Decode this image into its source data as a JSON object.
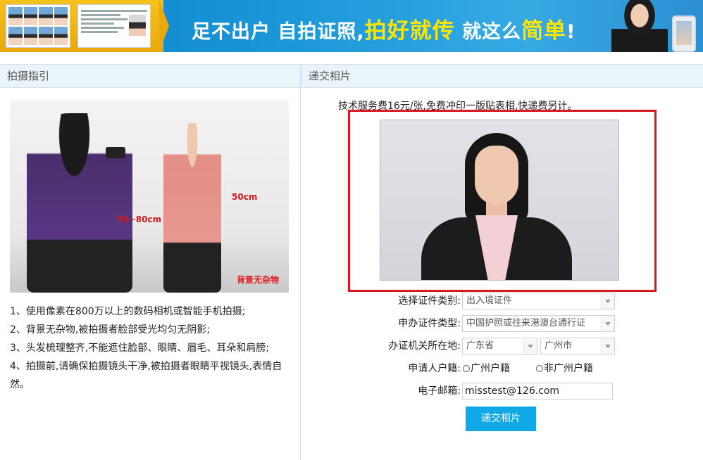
{
  "banner": {
    "slogan_part1": "足不出户 自拍证照,",
    "slogan_highlight1": "拍好就传",
    "slogan_part2": " 就这么",
    "slogan_highlight2": "简单",
    "slogan_end": "!"
  },
  "left": {
    "heading": "拍摄指引",
    "scene_labels": {
      "width_label": "50~80cm",
      "distance_label": "50cm",
      "background_note": "背景无杂物"
    },
    "instructions": [
      "1、使用像素在800万以上的数码相机或智能手机拍摄;",
      "2、背景无杂物,被拍摄者脸部受光均匀无阴影;",
      "3、头发梳理整齐,不能遮住脸部、眼睛、眉毛、耳朵和肩膀;",
      "4、拍摄前,请确保拍摄镜头干净,被拍摄者眼睛平视镜头,表情自然。"
    ]
  },
  "right": {
    "heading": "递交相片",
    "service_note": "技术服务费16元/张,免费冲印一版贴表相,快递费另计。",
    "form": {
      "doc_type_label": "选择证件类别:",
      "doc_type_value": "出入境证件",
      "apply_type_label": "申办证件类型:",
      "apply_type_value": "中国护照或往来港澳台通行证",
      "location_label": "办证机关所在地:",
      "province_value": "广东省",
      "city_value": "广州市",
      "household_label": "申请人户籍:",
      "household_option1": "广州户籍",
      "household_option2": "非广州户籍",
      "email_label": "电子邮箱:",
      "email_value": "misstest@126.com",
      "submit_label": "递交相片"
    }
  }
}
